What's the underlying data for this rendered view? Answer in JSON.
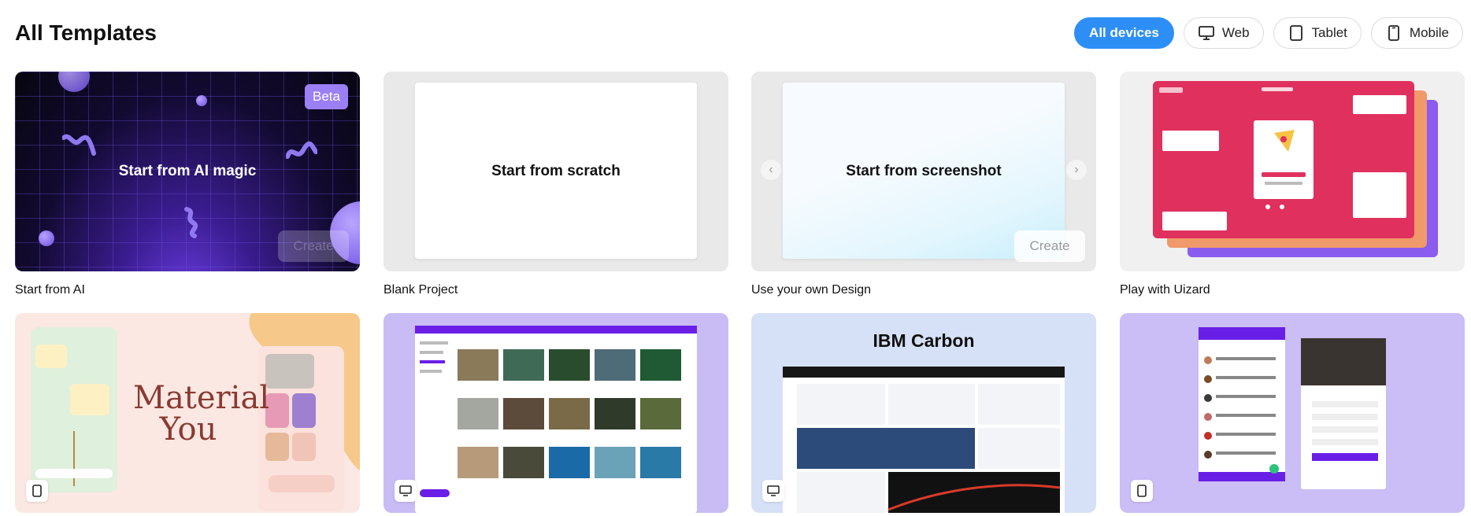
{
  "header": {
    "title": "All Templates",
    "filters": [
      {
        "label": "All devices",
        "icon": "none",
        "active": true
      },
      {
        "label": "Web",
        "icon": "monitor-icon",
        "active": false
      },
      {
        "label": "Tablet",
        "icon": "tablet-icon",
        "active": false
      },
      {
        "label": "Mobile",
        "icon": "mobile-icon",
        "active": false
      }
    ]
  },
  "cards": [
    {
      "caption": "Start from AI",
      "center_text": "Start from AI magic",
      "badge": "Beta",
      "button": "Create"
    },
    {
      "caption": "Blank Project",
      "center_text": "Start from scratch"
    },
    {
      "caption": "Use your own Design",
      "center_text": "Start from screenshot",
      "button": "Create"
    },
    {
      "caption": "Play with Uizard"
    },
    {
      "title_text": "Material You",
      "device": "mobile-icon"
    },
    {
      "device": "monitor-icon"
    },
    {
      "title_text": "IBM Carbon",
      "device": "monitor-icon"
    },
    {
      "device": "mobile-icon"
    }
  ],
  "colors": {
    "accent": "#2d8ff5",
    "ai_badge": "#9b7ff5",
    "uizard_pink": "#e0305e",
    "uizard_orange": "#f0996a",
    "uizard_purple": "#8b5cf0",
    "material_text": "#8a3a32",
    "lavender": "#c9bcf5",
    "carbon_bg": "#d6e1f7"
  }
}
